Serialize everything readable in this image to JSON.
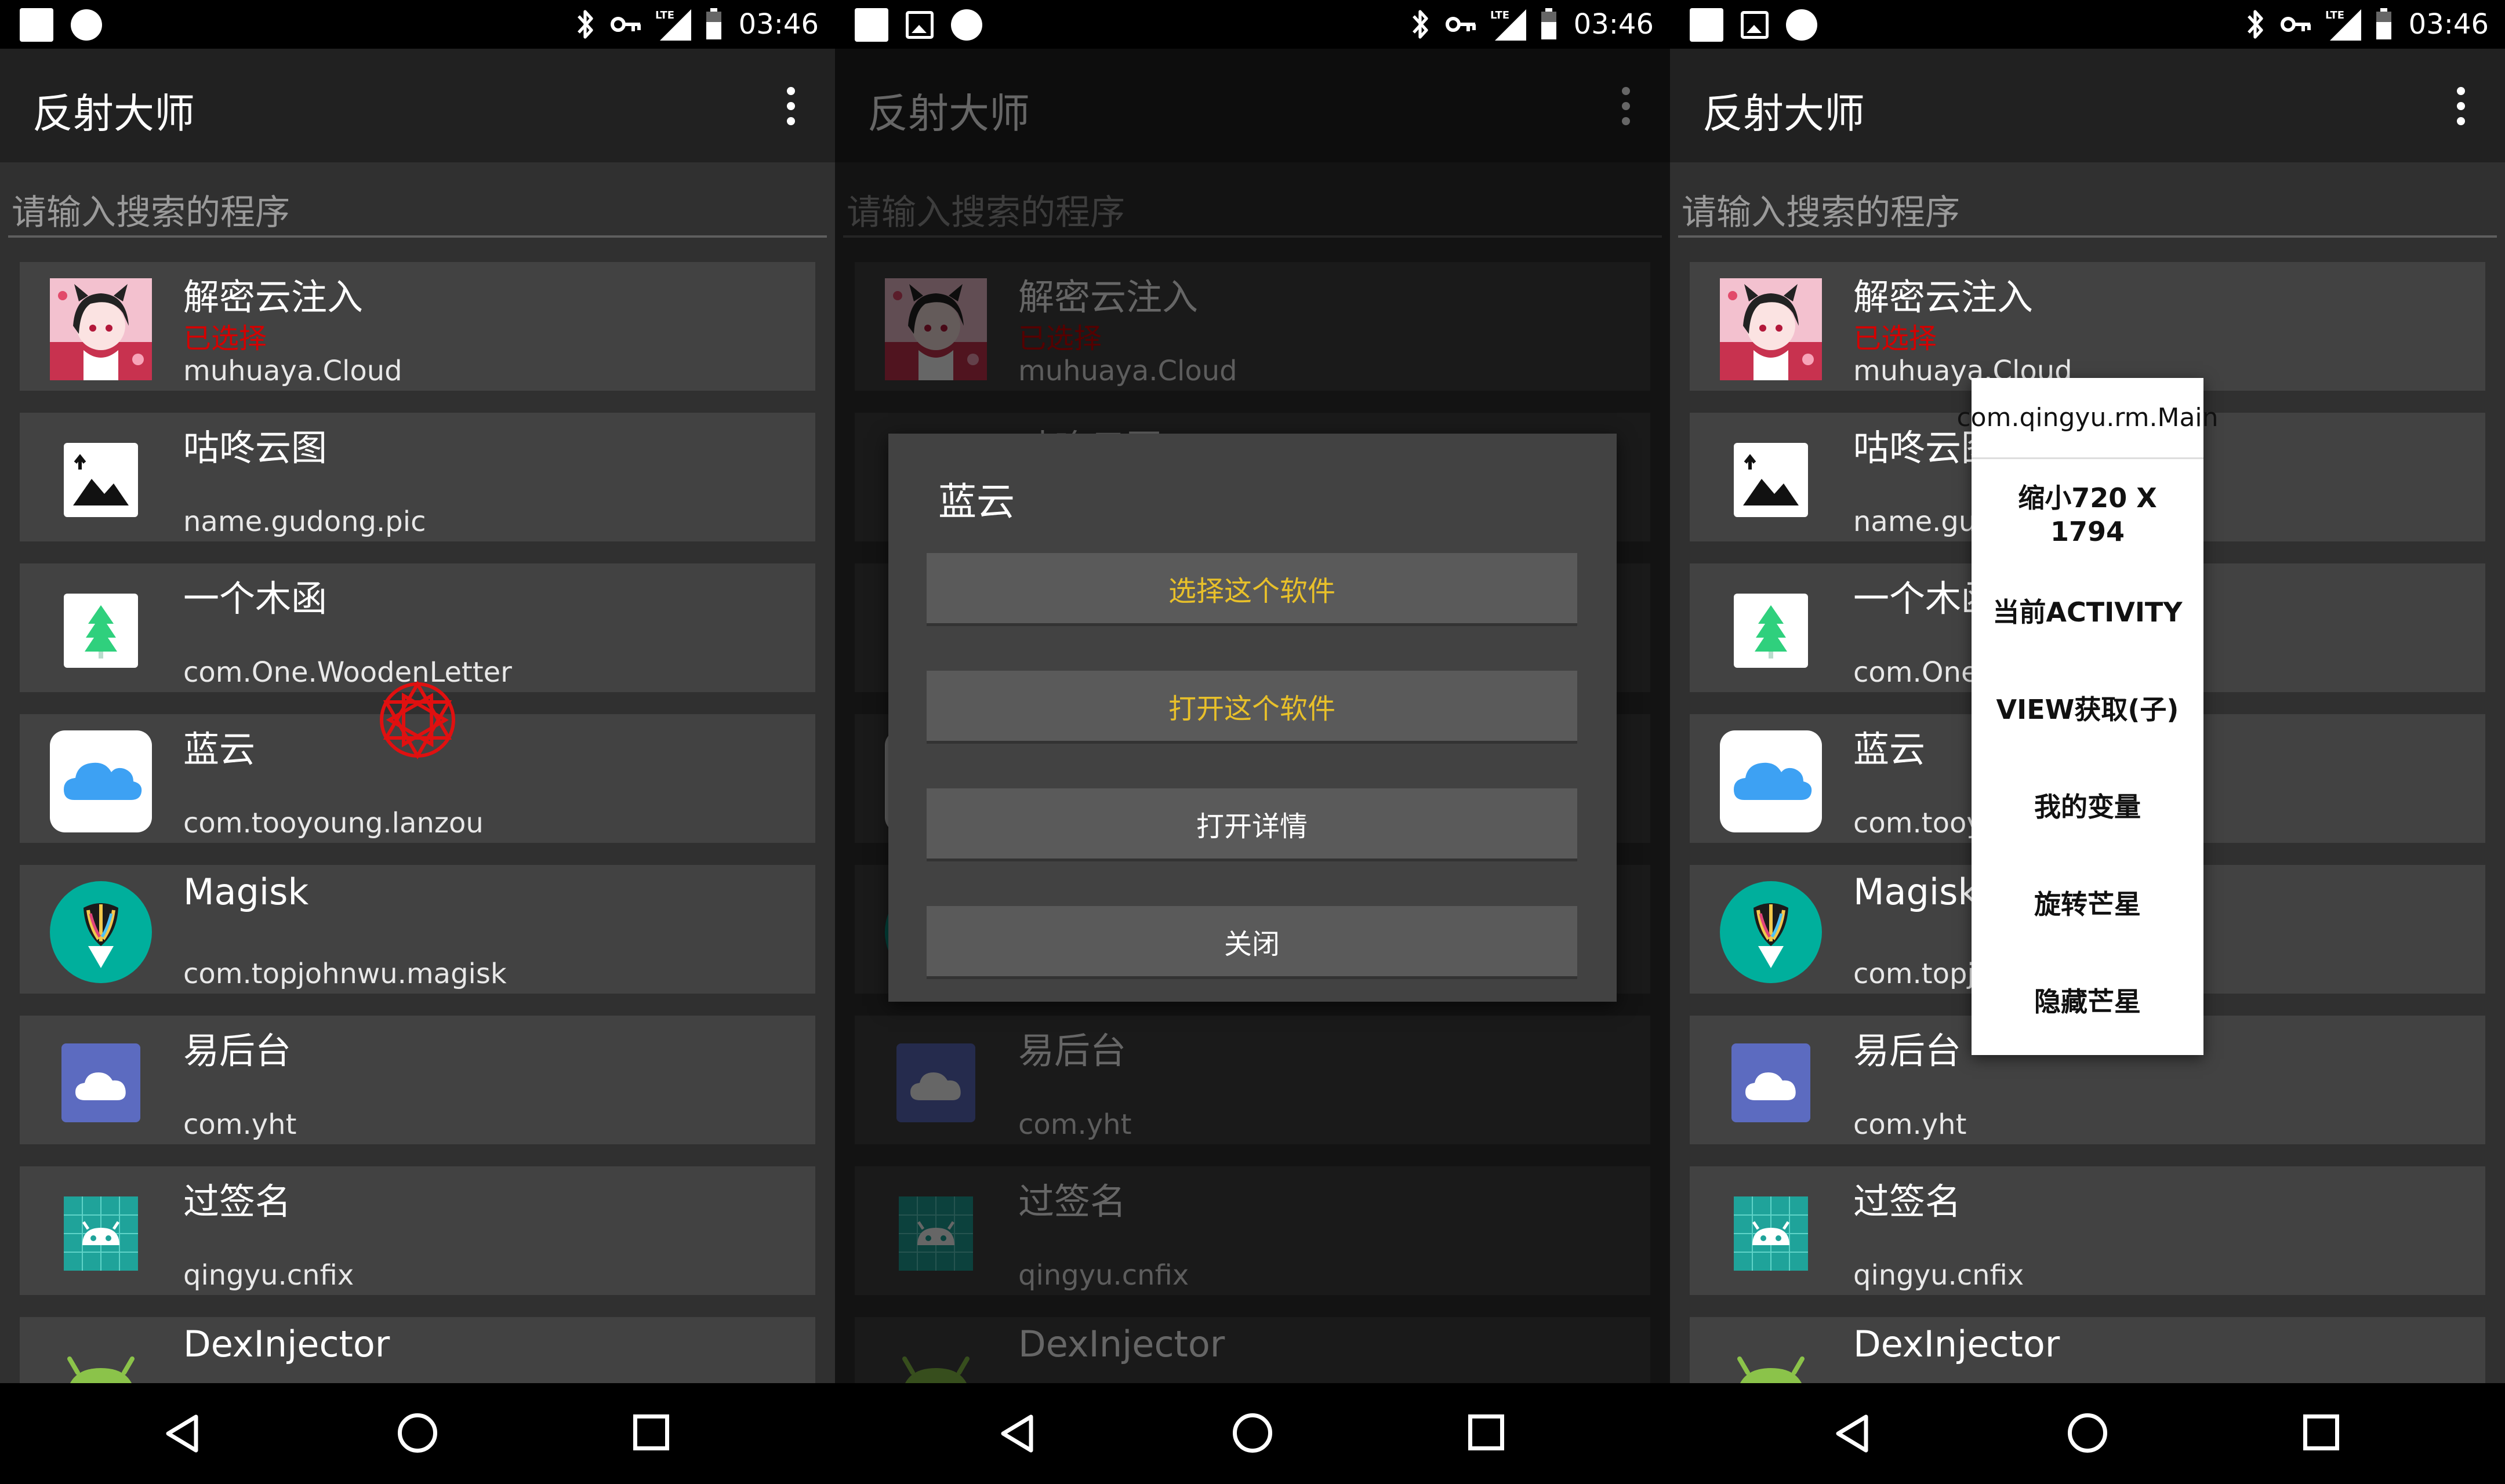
{
  "status_bar": {
    "time": "03:46",
    "icons": [
      "notification-square-icon",
      "notification-circle-icon",
      "image-notification-icon",
      "bluetooth-icon",
      "vpn-key-icon",
      "lte-signal-icon",
      "battery-icon"
    ]
  },
  "toolbar": {
    "title": "反射大师",
    "overflow_icon": "more-vert-icon"
  },
  "search": {
    "placeholder": "请输入搜索的程序"
  },
  "apps": [
    {
      "name": "解密云注入",
      "status": "已选择",
      "package": "muhuaya.Cloud",
      "icon": "anime-girl-icon"
    },
    {
      "name": "咕咚云图",
      "status": "",
      "package": "name.gudong.pic",
      "icon": "picture-icon"
    },
    {
      "name": "一个木函",
      "status": "",
      "package": "com.One.WoodenLetter",
      "icon": "tree-icon"
    },
    {
      "name": "蓝云",
      "status": "",
      "package": "com.tooyoung.lanzou",
      "icon": "cloud-icon"
    },
    {
      "name": "Magisk",
      "status": "",
      "package": "com.topjohnwu.magisk",
      "icon": "magisk-icon"
    },
    {
      "name": "易后台",
      "status": "",
      "package": "com.yht",
      "icon": "purple-cloud-icon"
    },
    {
      "name": "过签名",
      "status": "",
      "package": "qingyu.cnfix",
      "icon": "android-grid-icon"
    },
    {
      "name": "DexInjector",
      "status": "",
      "package": "",
      "icon": "android-icon"
    }
  ],
  "dialog": {
    "title": "蓝云",
    "buttons": [
      "选择这个软件",
      "打开这个软件",
      "打开详情",
      "关闭"
    ]
  },
  "popup": {
    "header": "com.qingyu.rm.Main",
    "items": [
      "缩小720 X 1794",
      "当前ACTIVITY",
      "VIEW获取(子)",
      "我的变量",
      "旋转芒星",
      "隐藏芒星"
    ]
  },
  "colors": {
    "accent_gold": "#e8c02a",
    "selected_red": "#d50000",
    "toolbar": "#212121",
    "list_bg": "#303030",
    "item_bg": "#424242"
  },
  "nav": {
    "icons": [
      "back-icon",
      "home-icon",
      "recents-icon"
    ]
  }
}
